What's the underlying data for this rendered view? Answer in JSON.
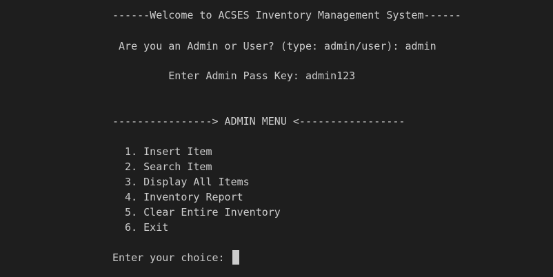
{
  "terminal": {
    "welcome_banner": "------Welcome to ACSES Inventory Management System------",
    "role_prompt": " Are you an Admin or User? (type: admin/user): admin",
    "passkey_prompt": "         Enter Admin Pass Key: admin123",
    "menu_header": "----------------> ADMIN MENU <-----------------",
    "menu_items": [
      "  1. Insert Item",
      "  2. Search Item",
      "  3. Display All Items",
      "  4. Inventory Report",
      "  5. Clear Entire Inventory",
      "  6. Exit"
    ],
    "choice_prompt": "Enter your choice: "
  },
  "colors": {
    "background": "#1e1e1e",
    "foreground": "#cccccc",
    "cursor": "#cccccc"
  }
}
